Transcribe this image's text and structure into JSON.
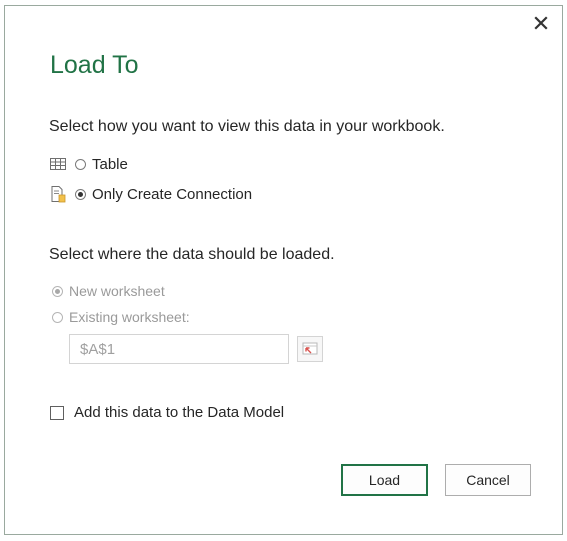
{
  "dialog": {
    "title": "Load To",
    "close_icon": "close-icon"
  },
  "view_section": {
    "prompt": "Select how you want to view this data in your workbook.",
    "options": [
      {
        "label": "Table",
        "icon": "table-icon",
        "selected": false
      },
      {
        "label": "Only Create Connection",
        "icon": "connection-icon",
        "selected": true
      }
    ]
  },
  "location_section": {
    "prompt": "Select where the data should be loaded.",
    "new_worksheet": {
      "label": "New worksheet",
      "selected": true,
      "enabled": false
    },
    "existing_worksheet": {
      "label": "Existing worksheet:",
      "selected": false,
      "enabled": false
    },
    "cell_reference": "$A$1",
    "range_picker_icon": "collapse-range-icon"
  },
  "data_model": {
    "label": "Add this data to the Data Model",
    "checked": false
  },
  "buttons": {
    "load": "Load",
    "cancel": "Cancel"
  },
  "colors": {
    "accent": "#217346",
    "disabled_text": "#9a9a9a"
  }
}
